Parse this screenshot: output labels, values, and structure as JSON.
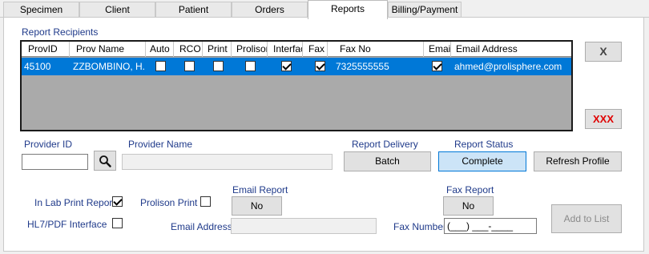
{
  "tabs": [
    {
      "label": "Specimen"
    },
    {
      "label": "Client"
    },
    {
      "label": "Patient"
    },
    {
      "label": "Orders"
    },
    {
      "label": "Reports"
    },
    {
      "label": "Billing/Payment"
    }
  ],
  "recipients": {
    "group_label": "Report Recipients",
    "columns": [
      "ProvID",
      "Prov Name",
      "Auto",
      "RCO",
      "Print",
      "Prolison",
      "Interfac",
      "Fax",
      "Fax No",
      "Email",
      "Email Address"
    ],
    "rows": [
      {
        "prov_id": "45100",
        "prov_name": "ZZBOMBINO, H...",
        "auto": false,
        "rco": false,
        "print": false,
        "prolison": false,
        "interface": true,
        "fax": true,
        "fax_no": "7325555555",
        "email": true,
        "email_address": "ahmed@prolisphere.com"
      }
    ]
  },
  "buttons": {
    "remove": "X",
    "remove_all": "XXX",
    "search_icon": "magnifier-icon",
    "delivery": "Batch",
    "status": "Complete",
    "refresh": "Refresh Profile",
    "email_report": "No",
    "fax_report": "No",
    "add_to_list": "Add to List"
  },
  "labels": {
    "provider_id": "Provider ID",
    "provider_name": "Provider Name",
    "report_delivery": "Report Delivery",
    "report_status": "Report Status",
    "in_lab_print": "In Lab Print Report",
    "prolison_print": "Prolison Print",
    "hl7": "HL7/PDF Interface",
    "email_report": "Email Report",
    "email_address": "Email Address",
    "fax_report": "Fax Report",
    "fax_number": "Fax Number"
  },
  "inputs": {
    "provider_id": "",
    "provider_name": "",
    "email_address": "",
    "fax_number": "(___) ___-____"
  },
  "checks": {
    "in_lab_print": true,
    "prolison_print": false,
    "hl7": false
  },
  "colors": {
    "selection": "#0078d7",
    "label_blue": "#1f3a8a",
    "remove_red": "#e00000"
  }
}
